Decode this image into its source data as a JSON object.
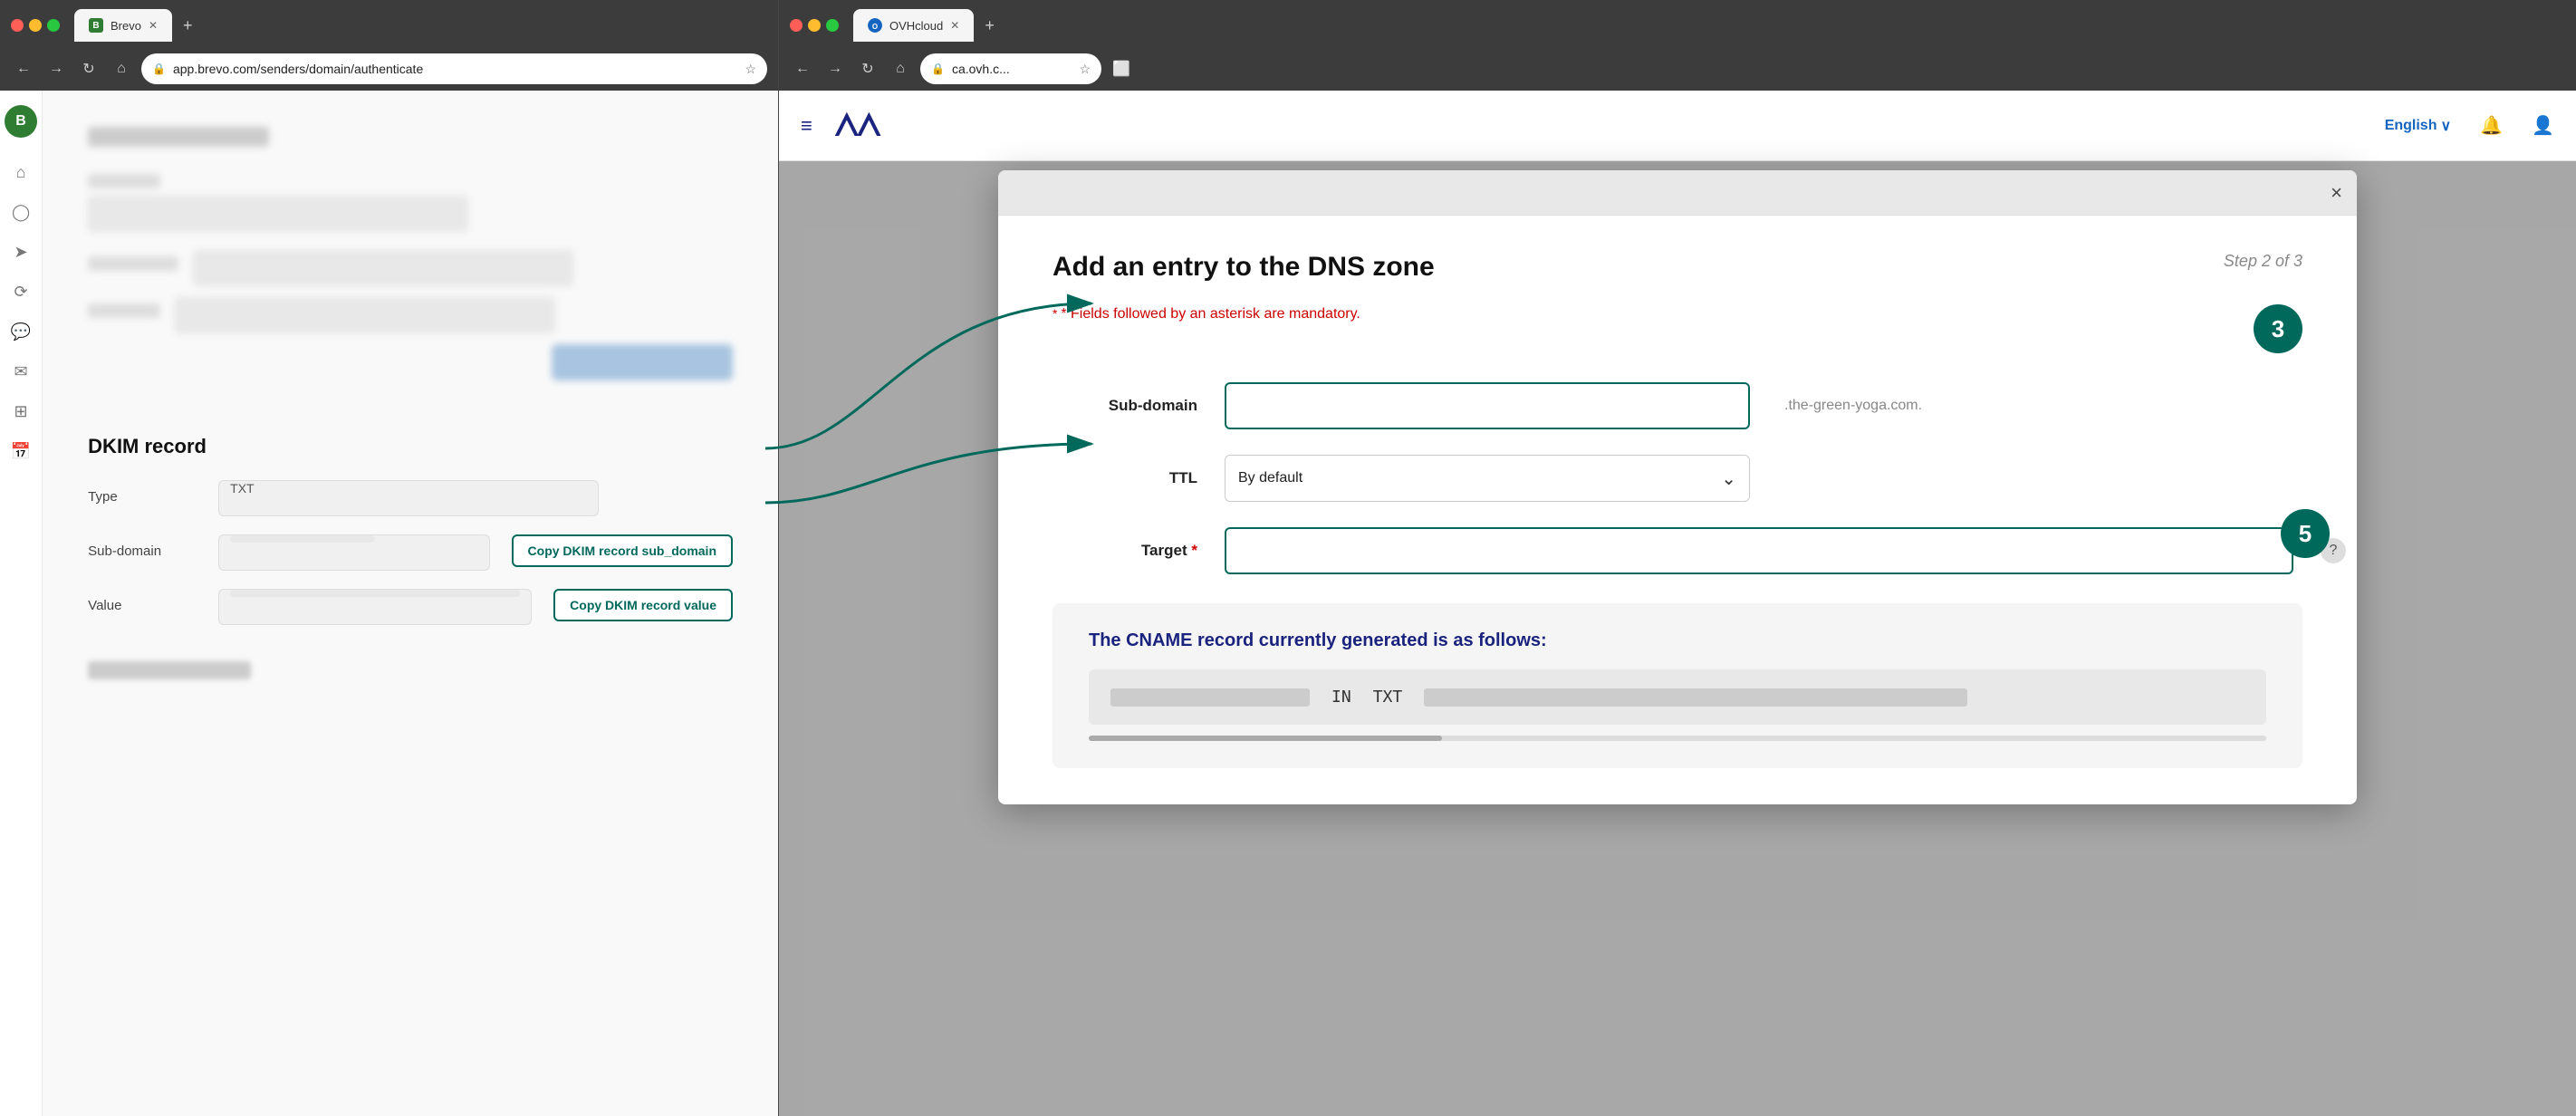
{
  "left_browser": {
    "tab_label": "Brevo",
    "tab_favicon_letter": "B",
    "url": "app.brevo.com/senders/domain/authenticate",
    "new_tab_icon": "+",
    "dkim_section": {
      "title": "DKIM record",
      "type_label": "Type",
      "type_value": "TXT",
      "subdomain_label": "Sub-domain",
      "value_label": "Value",
      "copy_subdomain_btn": "Copy DKIM record sub_domain",
      "copy_value_btn": "Copy DKIM record value"
    }
  },
  "right_browser": {
    "tab_label": "OVHcloud",
    "url": "ca.ovh.c...",
    "new_tab_icon": "+",
    "topbar": {
      "lang": "English",
      "lang_arrow": "∨"
    },
    "modal": {
      "close_icon": "×",
      "title": "Add an entry to the DNS zone",
      "step": "Step 2 of 3",
      "mandatory_note_prefix": "* Fields followed by an asterisk are mandatory.",
      "step3_badge": "3",
      "subdomain_label": "Sub-domain",
      "domain_suffix": ".the-green-yoga.com.",
      "ttl_label": "TTL",
      "ttl_value": "By default",
      "step5_badge": "5",
      "target_label": "Target",
      "target_required": "*",
      "cname_section": {
        "title": "The CNAME record currently generated is as follows:",
        "value_in": "IN",
        "value_txt": "TXT"
      }
    }
  },
  "icons": {
    "home": "⌂",
    "person": "◯",
    "send": "➤",
    "flow": "⟳",
    "chat": "💬",
    "inbox": "⬚",
    "grid": "⊞",
    "calendar": "📅",
    "hamburger": "≡",
    "bell": "🔔",
    "user_circle": "👤",
    "chevron_down": "⌄",
    "question": "?",
    "close": "×",
    "back": "←",
    "forward": "→",
    "refresh": "↻",
    "home_nav": "⌂",
    "shield": "🔒",
    "bookmark": "☆"
  }
}
